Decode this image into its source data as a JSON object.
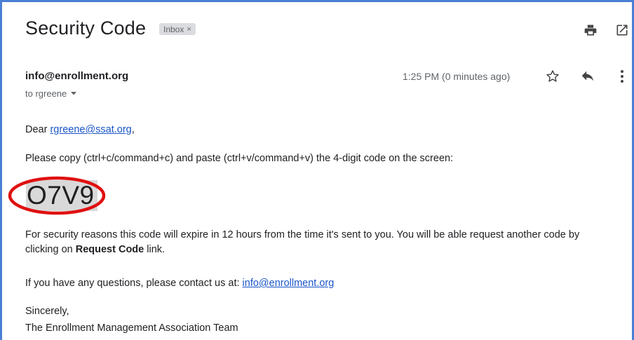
{
  "email": {
    "subject": "Security Code",
    "label": "Inbox",
    "sender": "info@enrollment.org",
    "recipient_prefix": "to rgreene",
    "time": "1:25 PM (0 minutes ago)"
  },
  "body": {
    "greeting_prefix": "Dear",
    "greeting_link": "rgreene@ssat.org",
    "greeting_suffix": ",",
    "instructions": "Please copy (ctrl+c/command+c) and paste (ctrl+v/command+v) the 4-digit code on the screen:",
    "code": "O7V9",
    "security_text": "For security reasons this code will expire in 12 hours from the time it's sent to you. You will be able request another code by clicking on",
    "security_bold": "Request Code",
    "security_suffix": "link.",
    "questions_text": "If you have any questions, please contact us at:",
    "questions_link": "info@enrollment.org",
    "closing": "Sincerely,",
    "signature": "The Enrollment Management Association Team"
  },
  "icons": {
    "print": "print-icon",
    "open_new_window": "open-in-new-window-icon",
    "star": "star-icon",
    "reply": "reply-icon",
    "more": "more-vertical-icon",
    "dropdown": "caret-down-icon",
    "chip_close": "close-icon"
  },
  "colors": {
    "frame": "#4a7fd4",
    "link": "#1a55c8",
    "highlight_circle": "#e01010",
    "code_background": "#d9d9d9"
  }
}
